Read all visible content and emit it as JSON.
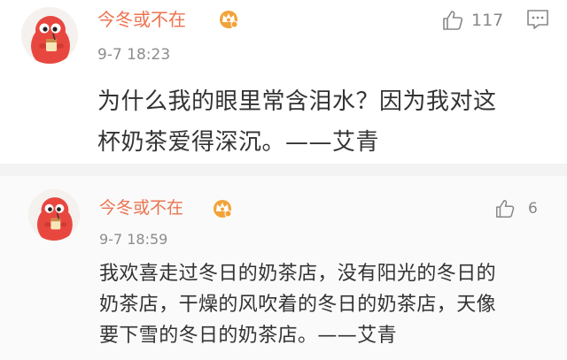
{
  "comments": [
    {
      "username": "今冬或不在",
      "timestamp": "9-7 18:23",
      "likes": "117",
      "text": "为什么我的眼里常含泪水？因为我对这\n杯奶茶爱得深沉。——艾青",
      "avatar_icon": "red-cartoon-avatar-icon",
      "badge_icon": "crown-vip-icon",
      "actions": [
        "like-icon",
        "reply-icon"
      ]
    },
    {
      "username": "今冬或不在",
      "timestamp": "9-7 18:59",
      "likes": "6",
      "text": "我欢喜走过冬日的奶茶店，没有阳光的冬日的\n奶茶店，干燥的风吹着的冬日的奶茶店，天像\n要下雪的冬日的奶茶店。——艾青",
      "avatar_icon": "red-cartoon-avatar-icon",
      "badge_icon": "crown-vip-icon",
      "actions": [
        "like-icon"
      ]
    }
  ],
  "colors": {
    "username": "#eb7350",
    "timestamp": "#8c8c8c",
    "body_text": "#333333",
    "icon_gray": "#888888",
    "avatar_red": "#e8473f",
    "crown_gold": "#f2a33a",
    "divider": "#f3f3f3"
  }
}
